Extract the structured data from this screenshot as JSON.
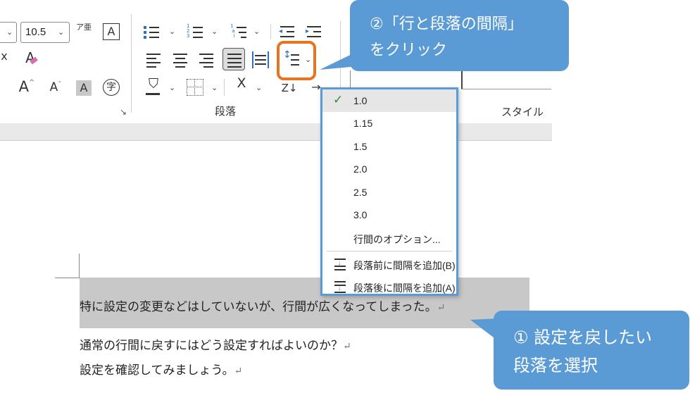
{
  "ribbon": {
    "font_size_value": "10.5",
    "ruby_icon_text": "ア亜",
    "border_char_icon": "A",
    "clear_format_icon": "A",
    "grow_font_icon": "A",
    "shrink_font_icon": "A",
    "char_shading_icon": "A",
    "enclose_char_icon": "字",
    "font_group_launcher": "↘",
    "paragraph_group_label": "段落",
    "style_group_label": "スタイル",
    "sort_icon_text": "Z↓"
  },
  "line_spacing_menu": {
    "items": [
      {
        "label": "1.0",
        "selected": true
      },
      {
        "label": "1.15",
        "selected": false
      },
      {
        "label": "1.5",
        "selected": false
      },
      {
        "label": "2.0",
        "selected": false
      },
      {
        "label": "2.5",
        "selected": false
      },
      {
        "label": "3.0",
        "selected": false
      }
    ],
    "options_label": "行間のオプション...",
    "add_before_label": "段落前に間隔を追加(B)",
    "add_after_label": "段落後に間隔を追加(A)"
  },
  "document": {
    "line1": "特に設定の変更などはしていないが、行間が広くなってしまった。",
    "line2": "通常の行間に戻すにはどう設定すればよいのか？",
    "line3": "設定を確認してみましょう。",
    "return_mark": "↵"
  },
  "callouts": {
    "top_line1": "②「行と段落の間隔」",
    "top_line2": "をクリック",
    "bottom_line1": "① 設定を戻したい",
    "bottom_line2": "段落を選択"
  },
  "colors": {
    "callout": "#5b9bd5",
    "highlight": "#e8741f",
    "selection": "#c8c8c8",
    "check": "#2a8a3e"
  }
}
